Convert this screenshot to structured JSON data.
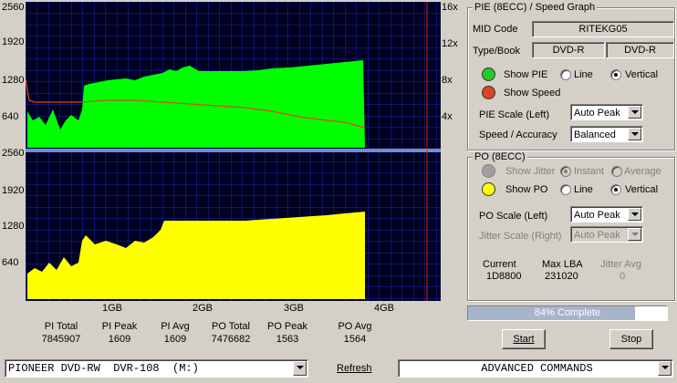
{
  "graph": {
    "left_ticks_top": [
      "2560",
      "1920",
      "1280",
      "640"
    ],
    "left_ticks_bottom": [
      "2560",
      "1920",
      "1280",
      "640"
    ],
    "right_ticks": [
      "16x",
      "12x",
      "8x",
      "4x"
    ],
    "x_ticks": [
      "1GB",
      "2GB",
      "3GB",
      "4GB"
    ]
  },
  "stats": [
    {
      "label": "PI Total",
      "value": "7845907"
    },
    {
      "label": "PI Peak",
      "value": "1609"
    },
    {
      "label": "PI Avg",
      "value": "1609"
    },
    {
      "label": "PO Total",
      "value": "7476682"
    },
    {
      "label": "PO Peak",
      "value": "1563"
    },
    {
      "label": "PO Avg",
      "value": "1564"
    }
  ],
  "pie_panel": {
    "title": "PIE (8ECC) / Speed Graph",
    "mid_label": "MID Code",
    "mid_value": "RITEKG05",
    "type_label": "Type/Book",
    "type_value": "DVD-R",
    "book_value": "DVD-R",
    "show_pie": "Show PIE",
    "show_speed": "Show Speed",
    "line": "Line",
    "vertical": "Vertical",
    "pie_scale_label": "PIE Scale (Left)",
    "pie_scale_value": "Auto Peak",
    "speed_acc_label": "Speed / Accuracy",
    "speed_acc_value": "Balanced",
    "pie_color": "#22cc22",
    "speed_color": "#dd4422"
  },
  "po_panel": {
    "title": "PO (8ECC)",
    "show_jitter": "Show Jitter",
    "instant": "Instant",
    "average": "Average",
    "show_po": "Show PO",
    "line": "Line",
    "vertical": "Vertical",
    "po_scale_label": "PO Scale (Left)",
    "po_scale_value": "Auto Peak",
    "jitter_scale_label": "Jitter Scale (Right)",
    "jitter_scale_value": "Auto Peak",
    "current_label": "Current",
    "current_value": "1D8800",
    "maxlba_label": "Max LBA",
    "maxlba_value": "231020",
    "jitter_avg_label": "Jitter Avg",
    "jitter_avg_value": "0",
    "po_color": "#ffff00"
  },
  "progress": {
    "text": "84% Complete",
    "fraction": 0.84
  },
  "buttons": {
    "start": "Start",
    "stop": "Stop",
    "refresh": "Refresh"
  },
  "drive": {
    "value": "PIONEER DVD-RW  DVR-108  (M:)"
  },
  "advanced": {
    "value": "ADVANCED COMMANDS"
  }
}
